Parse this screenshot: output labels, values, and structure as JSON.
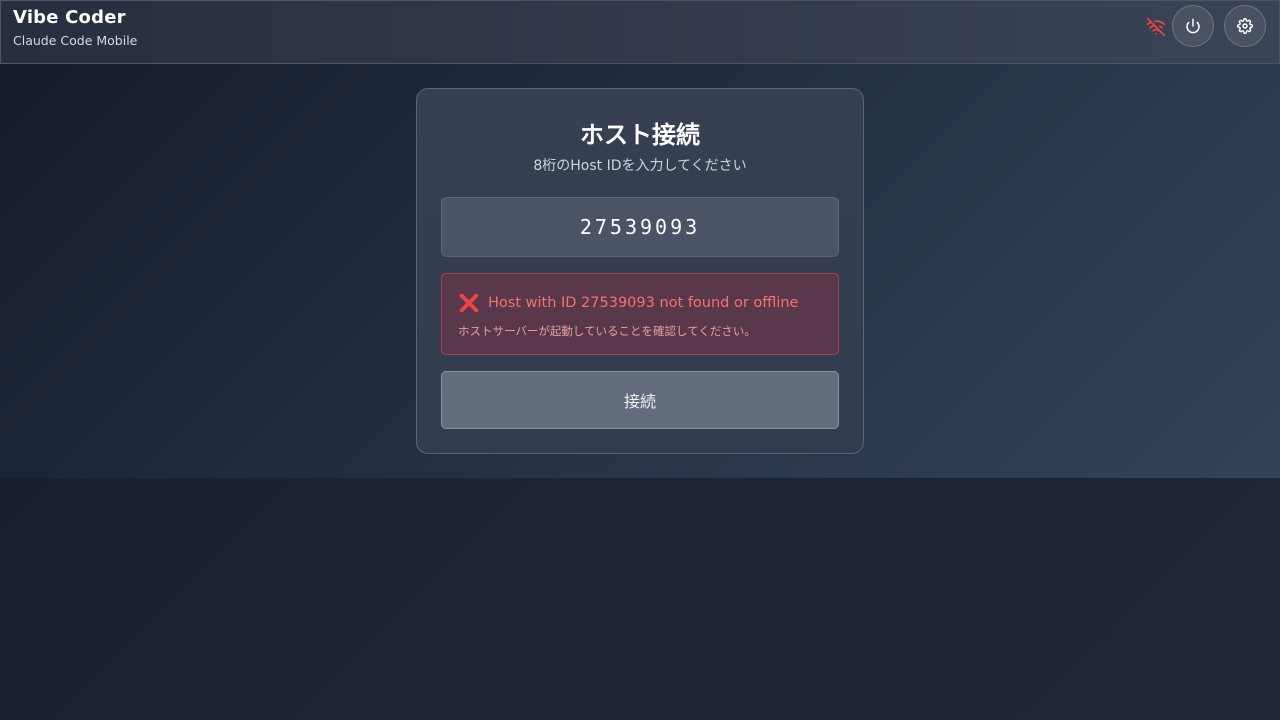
{
  "header": {
    "title": "Vibe Coder",
    "subtitle": "Claude Code Mobile",
    "connection_status_icon": "wifi-off-icon",
    "buttons": [
      {
        "name": "power-button",
        "icon": "power-icon"
      },
      {
        "name": "settings-button",
        "icon": "gear-icon"
      }
    ]
  },
  "connect_card": {
    "title": "ホスト接続",
    "subtitle": "8桁のHost IDを入力してください",
    "host_id_value": "27539093",
    "error": {
      "icon": "cross-mark-icon",
      "message": "Host with ID 27539093 not found or offline",
      "hint": "ホストサーバーが起動していることを確認してください。"
    },
    "connect_label": "接続"
  },
  "colors": {
    "error_text": "#f87171",
    "error_border": "#b4404d",
    "offline_icon": "#ef4444"
  }
}
